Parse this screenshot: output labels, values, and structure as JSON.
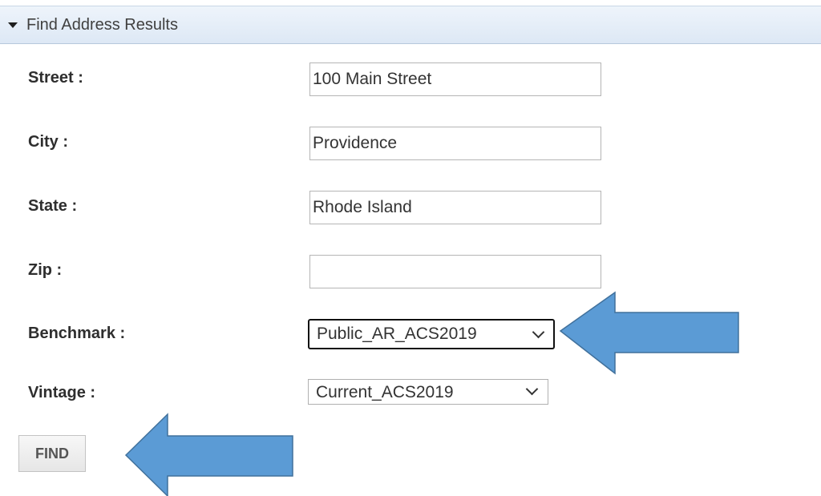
{
  "panel": {
    "title": "Find Address Results",
    "toggle_icon": "caret-down-icon"
  },
  "form": {
    "street_label": "Street :",
    "street_value": "100 Main Street",
    "city_label": "City :",
    "city_value": "Providence",
    "state_label": "State :",
    "state_value": "Rhode Island",
    "zip_label": "Zip :",
    "zip_value": "",
    "benchmark_label": "Benchmark :",
    "benchmark_value": "Public_AR_ACS2019",
    "vintage_label": "Vintage :",
    "vintage_value": "Current_ACS2019",
    "find_label": "FIND"
  },
  "annotations": {
    "arrow_color": "#5b9bd5",
    "arrow_border": "#41719c"
  },
  "colors": {
    "header_bg": "#e3ecf7",
    "label_text": "#2e2e2e"
  }
}
